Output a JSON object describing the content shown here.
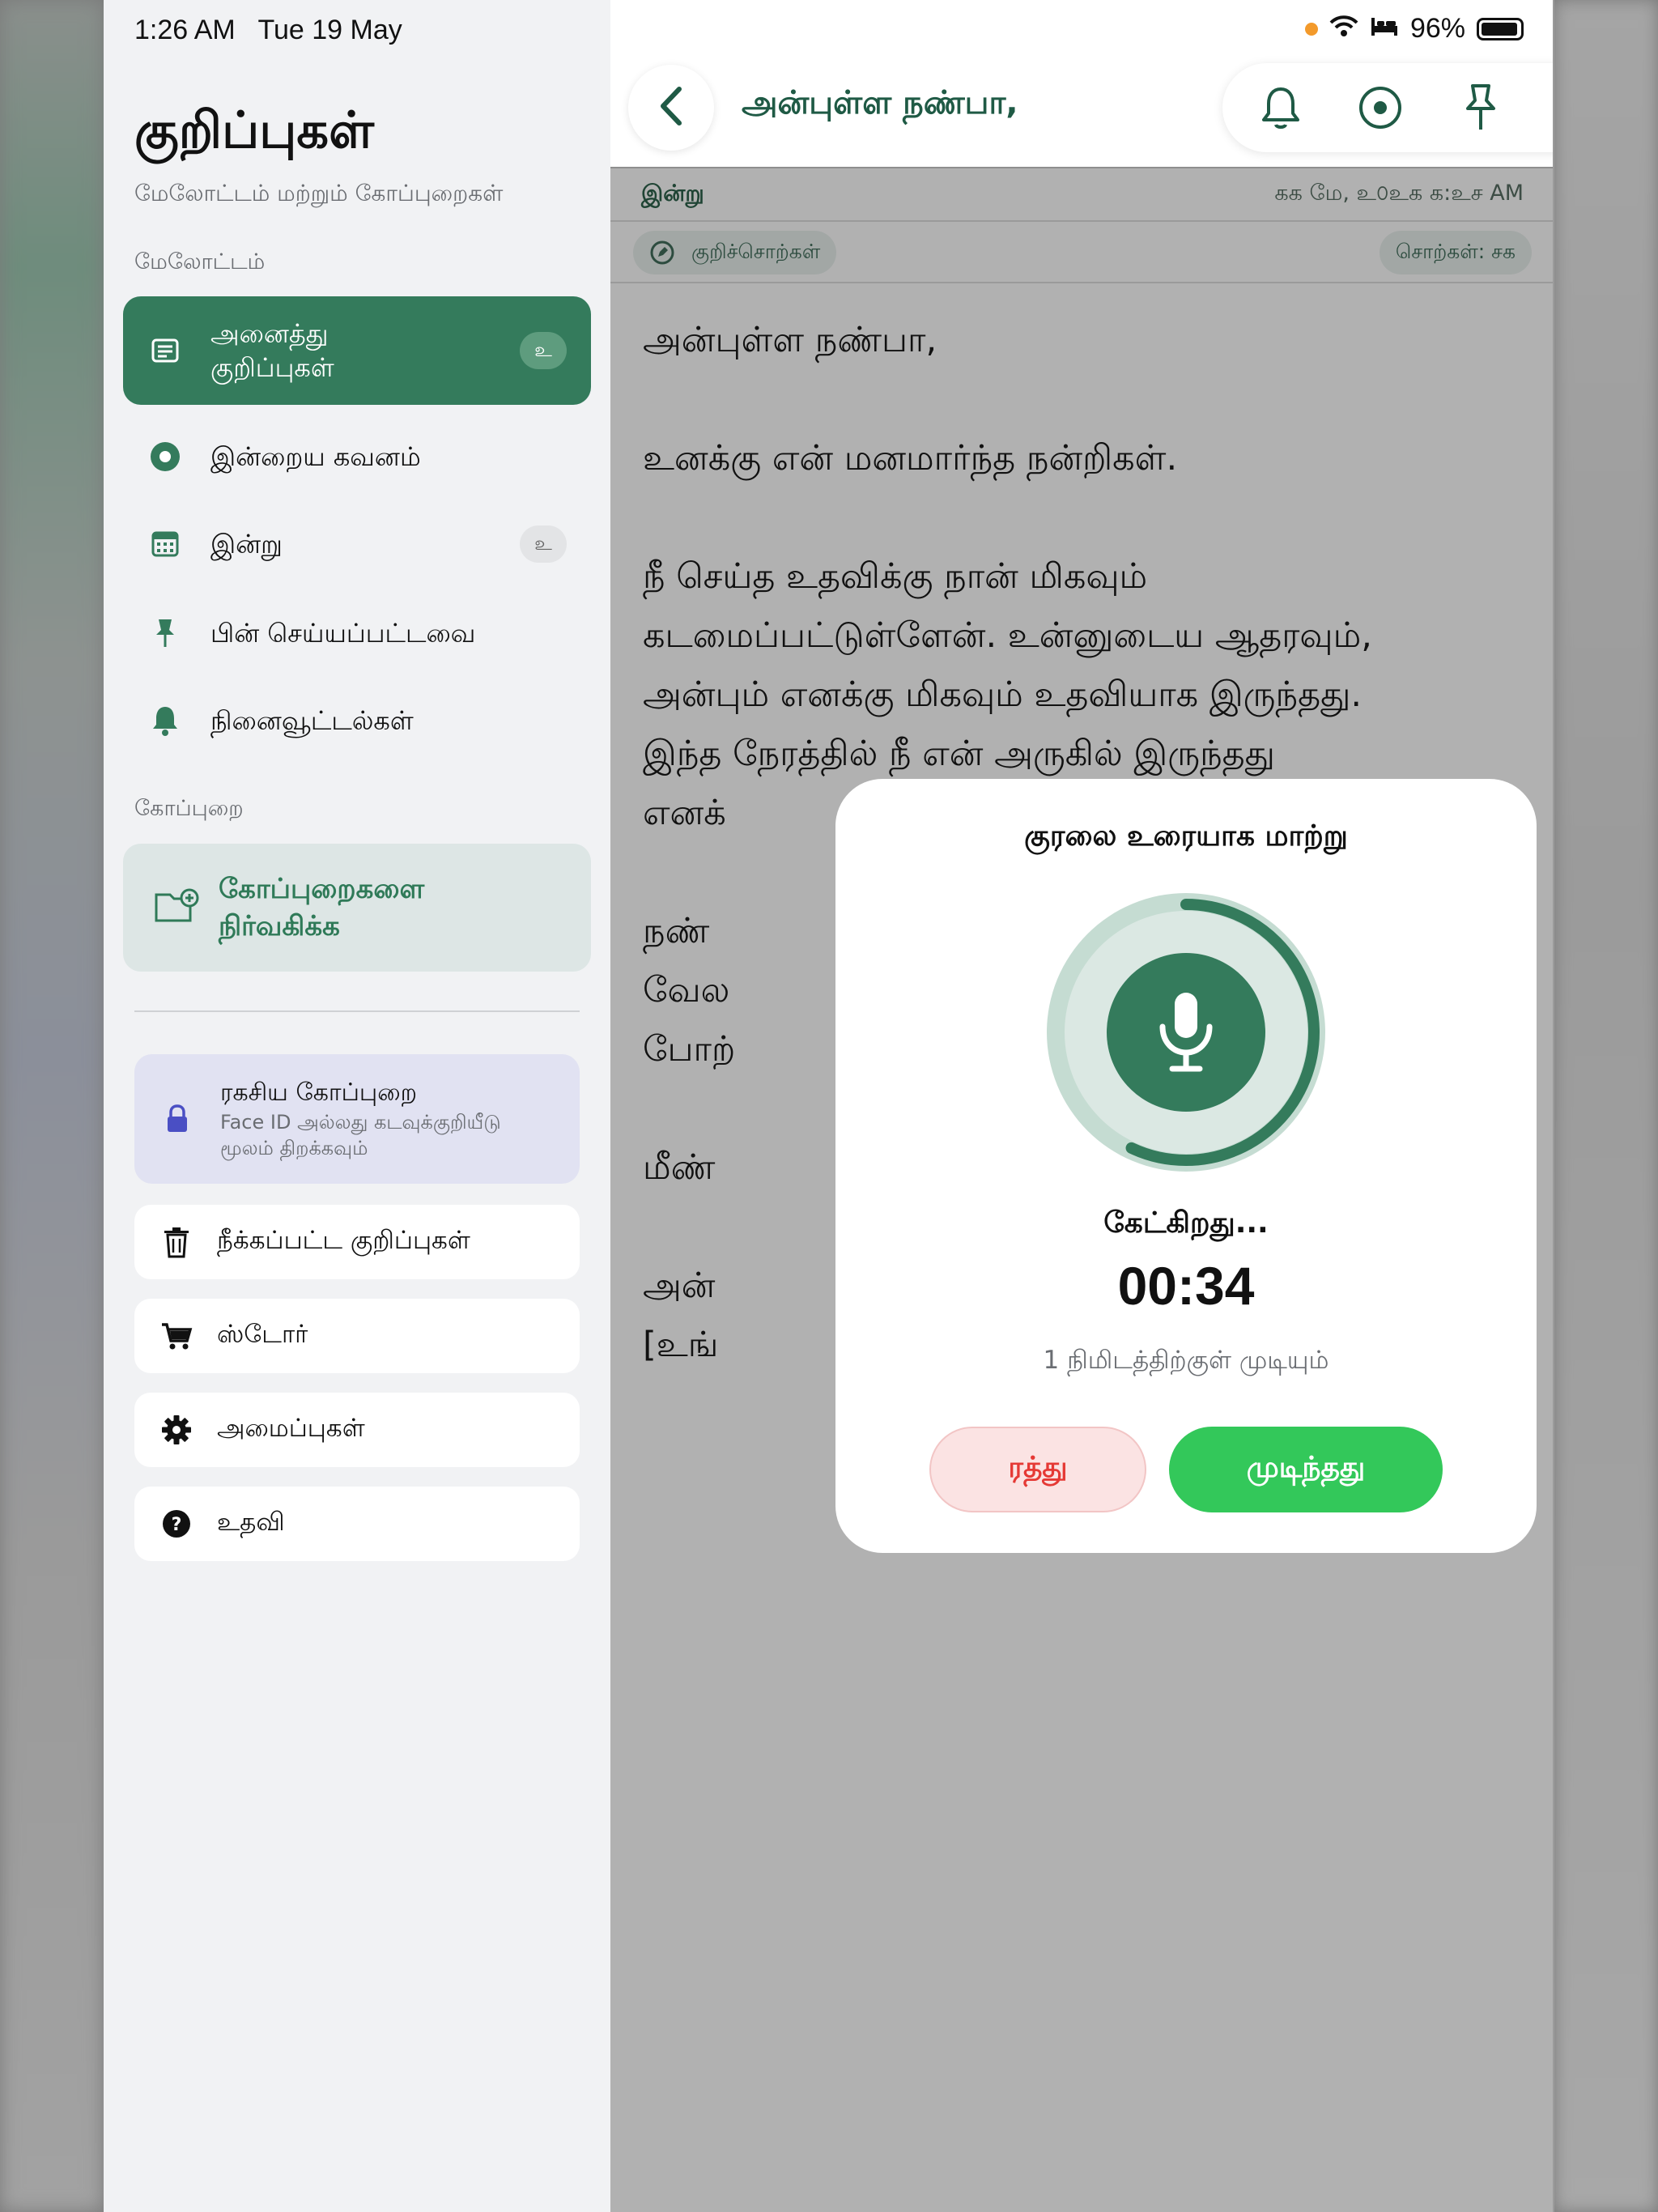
{
  "status_bar": {
    "time_date": "1:26 AM   Tue 19 May",
    "battery": "96%",
    "battery_level": 0.96
  },
  "sidebar": {
    "title": "குறிப்புகள்",
    "subtitle": "மேலோட்டம் மற்றும் கோப்புறைகள்",
    "section_overview": "மேலோட்டம்",
    "items": [
      {
        "label": "அனைத்து\nகுறிப்புகள்",
        "badge": "உ",
        "icon": "note-icon",
        "active": true
      },
      {
        "label": "இன்றைய கவனம்",
        "badge": "",
        "icon": "focus-icon"
      },
      {
        "label": "இன்று",
        "badge": "உ",
        "icon": "calendar-icon"
      },
      {
        "label": "பின் செய்யப்பட்டவை",
        "badge": "",
        "icon": "pin-icon"
      },
      {
        "label": "நினைவூட்டல்கள்",
        "badge": "",
        "icon": "bell-icon"
      }
    ],
    "section_folders": "கோப்புறை",
    "manage_folders": "கோப்புறைகளை\nநிர்வகிக்க",
    "secret_folder": {
      "title": "ரகசிய கோப்புறை",
      "subtitle": "Face ID அல்லது கடவுக்குறியீடு\nமூலம் திறக்கவும்"
    },
    "bottom_items": [
      {
        "label": "நீக்கப்பட்ட குறிப்புகள்",
        "icon": "trash-icon"
      },
      {
        "label": "ஸ்டோர்",
        "icon": "cart-icon"
      },
      {
        "label": "அமைப்புகள்",
        "icon": "gear-icon"
      },
      {
        "label": "உதவி",
        "icon": "help-icon"
      }
    ]
  },
  "note": {
    "title": "அன்புள்ள நண்பா,",
    "date_label": "இன்று",
    "timestamp": "கக மே, உ௦உக க:உச AM",
    "tag_chip": "குறிச்சொற்கள்",
    "word_count": "சொற்கள்: சக",
    "body": "அன்புள்ள நண்பா,\n\nஉனக்கு என் மனமார்ந்த நன்றிகள்.\n\nநீ செய்த உதவிக்கு நான் மிகவும்\nகடமைப்பட்டுள்ளேன். உன்னுடைய ஆதரவும்,\nஅன்பும் எனக்கு மிகவும் உதவியாக இருந்தது.\nஇந்த நேரத்தில் நீ என் அருகில் இருந்தது\nஎனக்\n\nநண்\nவேல\nபோற்\n\nமீண்\n\nஅன்\n[உங்"
  },
  "modal": {
    "title": "குரலை உரையாக மாற்று",
    "status": "கேட்கிறது...",
    "timer": "00:34",
    "limit_note": "1 நிமிடத்திற்குள் முடியும்",
    "progress_fraction": 0.57,
    "cancel_label": "ரத்து",
    "done_label": "முடிந்தது"
  },
  "colors": {
    "accent_green": "#347b5c",
    "done_green": "#33c85a",
    "cancel_red": "#e53935",
    "trash_red": "#e53935"
  }
}
